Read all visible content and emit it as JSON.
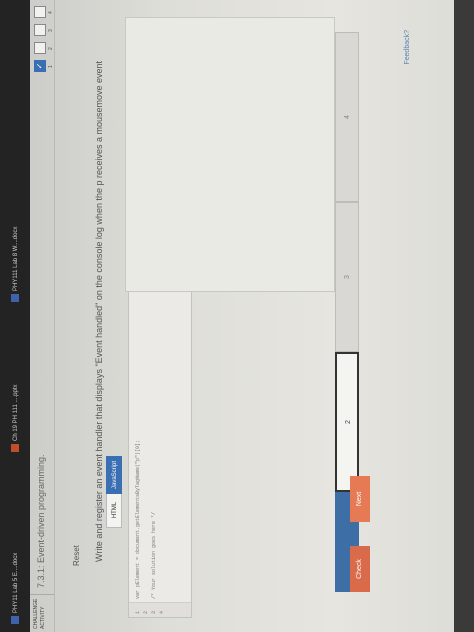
{
  "activity": {
    "label": "CHALLENGE ACTIVITY",
    "title": "7.3.1: Event-driven programming."
  },
  "progress": {
    "items": [
      "1",
      "2",
      "3",
      "4"
    ],
    "done_icon": "check-icon"
  },
  "reset_label": "Reset",
  "prompt": "Write and register an event handler that displays \"Event handled\" on the console log when the p receives a mousemove event",
  "tabs": {
    "html": "HTML",
    "js": "JavaScript"
  },
  "code": {
    "lines": [
      "1",
      "2",
      "3",
      "4"
    ],
    "text": [
      "var pElement = document.getElementsByTagName(\"p\")[0];",
      "",
      "/* Your solution goes here */",
      ""
    ]
  },
  "stages": [
    "",
    "2",
    "3",
    "4"
  ],
  "buttons": {
    "check": "Check",
    "next": "Next"
  },
  "feedback": "Feedback?",
  "taskbar": {
    "items": [
      "PHY11 Lab 5 E....docx",
      "Ch 19 PH 111 ....pptx",
      "PHY111 Lab 8 W....docx"
    ]
  },
  "colors": {
    "accent": "#3b6fb3",
    "check": "#d96a4a",
    "next": "#e57a55"
  }
}
